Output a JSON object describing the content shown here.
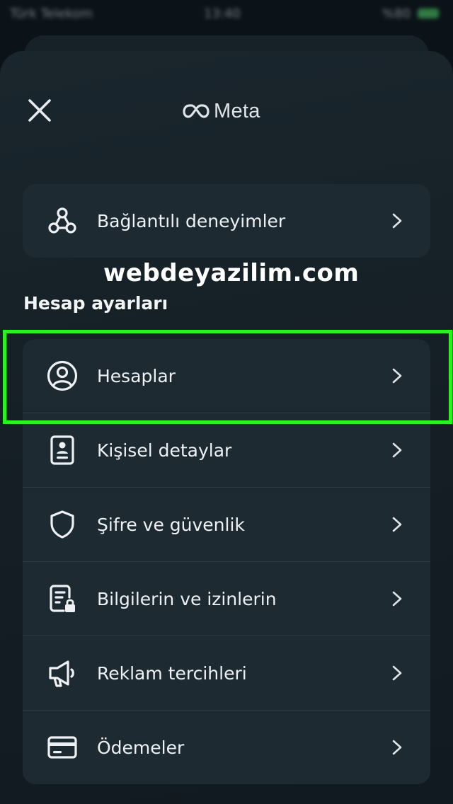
{
  "status_bar": {
    "carrier": "Türk Telekom",
    "time": "13:40",
    "battery": "%80"
  },
  "header": {
    "close_icon": "close-icon",
    "logo_text": "Meta"
  },
  "connected": {
    "icon": "connected-nodes-icon",
    "label": "Bağlantılı deneyimler"
  },
  "watermark": "webdeyazilim.com",
  "section_title": "Hesap ayarları",
  "accounts": {
    "icon": "profile-circle-icon",
    "label": "Hesaplar"
  },
  "settings_items": [
    {
      "icon": "id-card-icon",
      "label": "Kişisel detaylar"
    },
    {
      "icon": "shield-icon",
      "label": "Şifre ve güvenlik"
    },
    {
      "icon": "document-lock-icon",
      "label": "Bilgilerin ve izinlerin"
    },
    {
      "icon": "megaphone-icon",
      "label": "Reklam tercihleri"
    },
    {
      "icon": "credit-card-icon",
      "label": "Ödemeler"
    }
  ],
  "colors": {
    "background": "#0b1116",
    "card": "#1d2a31",
    "text": "#eef1f3",
    "highlight": "#29f31e"
  }
}
